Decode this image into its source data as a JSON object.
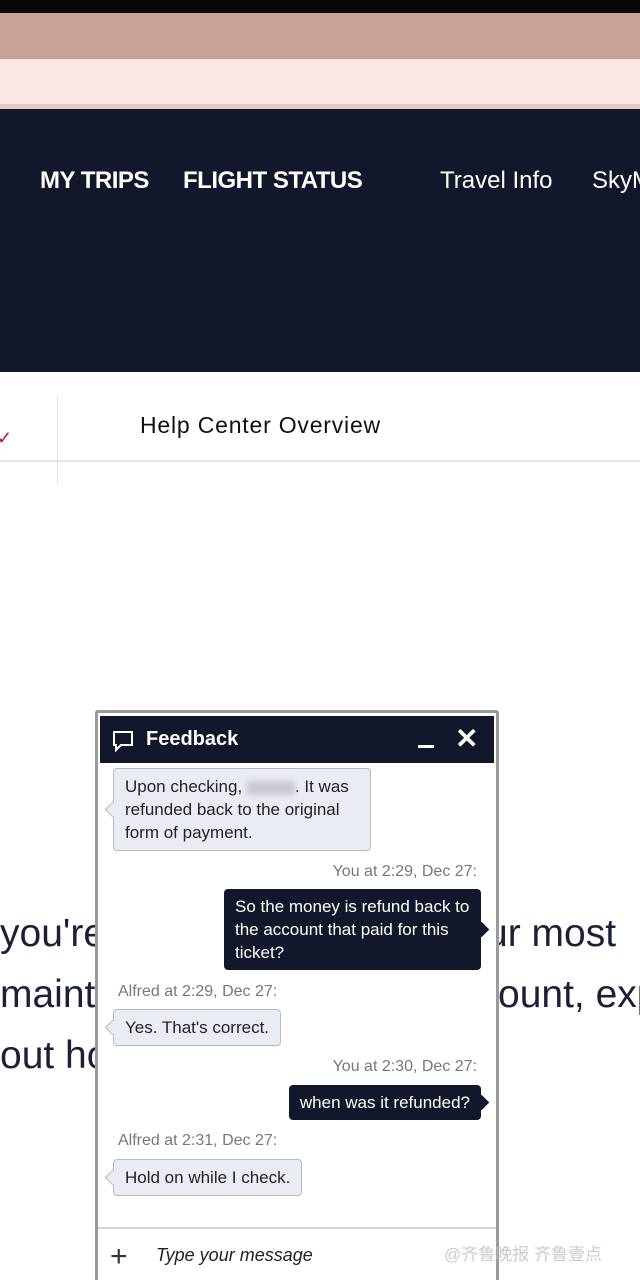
{
  "nav": {
    "items": [
      "MY TRIPS",
      "FLIGHT STATUS",
      "Travel Info",
      "SkyM"
    ],
    "partial_left": "I"
  },
  "subnav": {
    "title": "Help Center Overview"
  },
  "background_text": {
    "line1_left": "you're",
    "line1_right": "ur most",
    "line2_left": "mainta",
    "line2_right": "ount, exp",
    "line3_left": "out ho"
  },
  "chat": {
    "title": "Feedback",
    "messages": [
      {
        "from": "agent",
        "meta": "",
        "text_before": "Upon checking,",
        "text_after": ". It was refunded back to the original form of payment."
      },
      {
        "from": "user",
        "meta": "You at 2:29, Dec 27:",
        "text": "So the money is refund back to the account that paid for this ticket?"
      },
      {
        "from": "agent",
        "meta": "Alfred at 2:29, Dec 27:",
        "text": "Yes. That's correct."
      },
      {
        "from": "user",
        "meta": "You at 2:30, Dec 27:",
        "text": "when was it refunded?"
      },
      {
        "from": "agent",
        "meta": "Alfred at 2:31, Dec 27:",
        "text": "Hold on while I check."
      }
    ],
    "input_placeholder": "Type your message"
  },
  "watermark": "@齐鲁晚报 齐鲁壹点",
  "colors": {
    "navy": "#13172c",
    "accent_red": "#c0143c"
  }
}
